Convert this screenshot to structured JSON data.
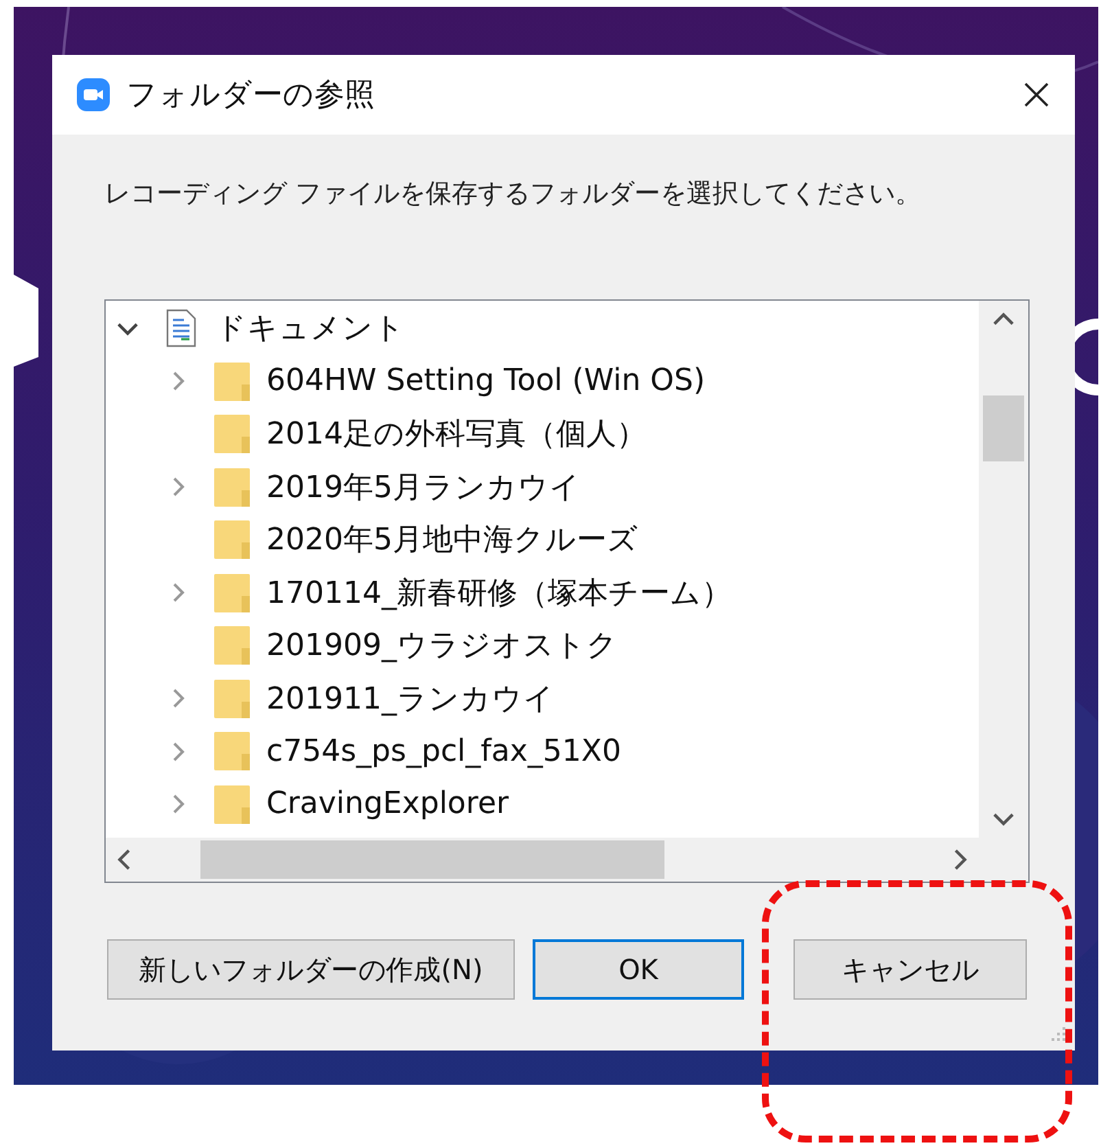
{
  "window": {
    "title": "フォルダーの参照"
  },
  "instruction": "レコーディング ファイルを保存するフォルダーを選択してください。",
  "tree": [
    {
      "label": "ドキュメント",
      "kind": "document",
      "expanded": true,
      "children": [
        {
          "label": "604HW Setting Tool (Win OS)",
          "kind": "folder",
          "expandable": true
        },
        {
          "label": "2014足の外科写真（個人）",
          "kind": "folder",
          "expandable": false
        },
        {
          "label": "2019年5月ランカウイ",
          "kind": "folder",
          "expandable": true
        },
        {
          "label": "2020年5月地中海クルーズ",
          "kind": "folder",
          "expandable": false
        },
        {
          "label": "170114_新春研修（塚本チーム）",
          "kind": "folder",
          "expandable": true
        },
        {
          "label": "201909_ウラジオストク",
          "kind": "folder",
          "expandable": false
        },
        {
          "label": "201911_ランカウイ",
          "kind": "folder",
          "expandable": true
        },
        {
          "label": "c754s_ps_pcl_fax_51X0",
          "kind": "folder",
          "expandable": true
        },
        {
          "label": "CravingExplorer",
          "kind": "folder",
          "expandable": true
        }
      ]
    }
  ],
  "buttons": [
    {
      "label": "新しいフォルダーの作成(N)",
      "default": false
    },
    {
      "label": "OK",
      "default": true
    },
    {
      "label": "キャンセル",
      "default": false
    }
  ],
  "annotation": {
    "kind": "dashed-outline"
  }
}
